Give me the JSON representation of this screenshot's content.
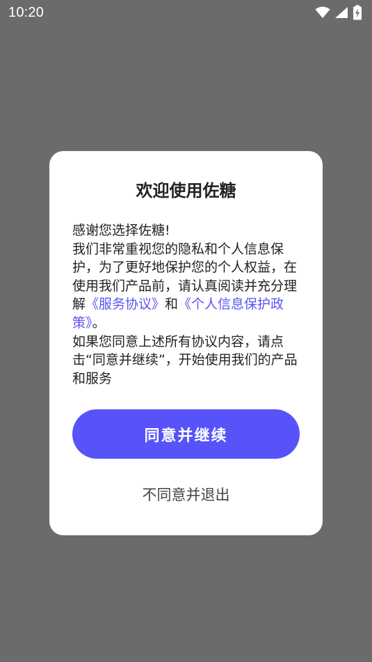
{
  "status_bar": {
    "time": "10:20",
    "icons": [
      "wifi-icon",
      "cellular-signal-icon",
      "battery-charging-icon"
    ],
    "text_color": "#ffffff"
  },
  "colors": {
    "overlay": "#6b6b6b",
    "dialog_bg": "#ffffff",
    "accent": "#5753f9",
    "link": "#5b53f5"
  },
  "dialog": {
    "title": "欢迎使用佐糖",
    "line_thanks": "感谢您选择佐糖!",
    "para1_before": "我们非常重视您的隐私和个人信息保护，为了更好地保护您的个人权益，在使用我们产品前，请认真阅读并充分理解",
    "link_service": "《服务协议》",
    "para1_middle": "和",
    "link_privacy": "《个人信息保护政策》",
    "para1_end": "。",
    "para2": "如果您同意上述所有协议内容，请点击“同意并继续”，开始使用我们的产品和服务",
    "agree_label": "同意并继续",
    "decline_label": "不同意并退出"
  }
}
